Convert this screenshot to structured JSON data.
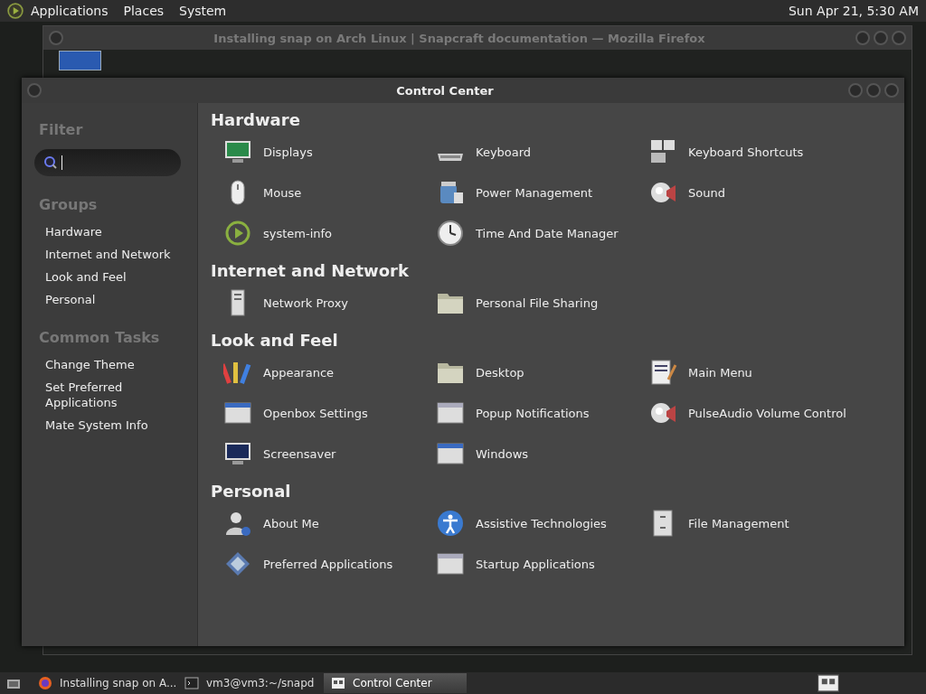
{
  "top_panel": {
    "menus": [
      "Applications",
      "Places",
      "System"
    ],
    "clock": "Sun Apr 21,  5:30 AM"
  },
  "background_window": {
    "title": "Installing snap on Arch Linux | Snapcraft documentation — Mozilla Firefox"
  },
  "window": {
    "title": "Control Center",
    "sidebar": {
      "filter_label": "Filter",
      "groups_label": "Groups",
      "groups": [
        "Hardware",
        "Internet and Network",
        "Look and Feel",
        "Personal"
      ],
      "tasks_label": "Common Tasks",
      "tasks": [
        "Change Theme",
        "Set Preferred Applications",
        "Mate System Info"
      ]
    },
    "sections": [
      {
        "title": "Hardware",
        "items": [
          {
            "label": "Displays"
          },
          {
            "label": "Keyboard"
          },
          {
            "label": "Keyboard Shortcuts"
          },
          {
            "label": "Mouse"
          },
          {
            "label": "Power Management"
          },
          {
            "label": "Sound"
          },
          {
            "label": "system-info"
          },
          {
            "label": "Time And Date Manager"
          }
        ]
      },
      {
        "title": "Internet and Network",
        "items": [
          {
            "label": "Network Proxy"
          },
          {
            "label": "Personal File Sharing"
          }
        ]
      },
      {
        "title": "Look and Feel",
        "items": [
          {
            "label": "Appearance"
          },
          {
            "label": "Desktop"
          },
          {
            "label": "Main Menu"
          },
          {
            "label": "Openbox Settings"
          },
          {
            "label": "Popup Notifications"
          },
          {
            "label": "PulseAudio Volume Control"
          },
          {
            "label": "Screensaver"
          },
          {
            "label": "Windows"
          }
        ]
      },
      {
        "title": "Personal",
        "items": [
          {
            "label": "About Me"
          },
          {
            "label": "Assistive Technologies"
          },
          {
            "label": "File Management"
          },
          {
            "label": "Preferred Applications"
          },
          {
            "label": "Startup Applications"
          }
        ]
      }
    ]
  },
  "taskbar": {
    "items": [
      {
        "label": "Installing snap on A...",
        "selected": false
      },
      {
        "label": "vm3@vm3:~/snapd",
        "selected": false
      },
      {
        "label": "Control Center",
        "selected": true
      }
    ]
  }
}
